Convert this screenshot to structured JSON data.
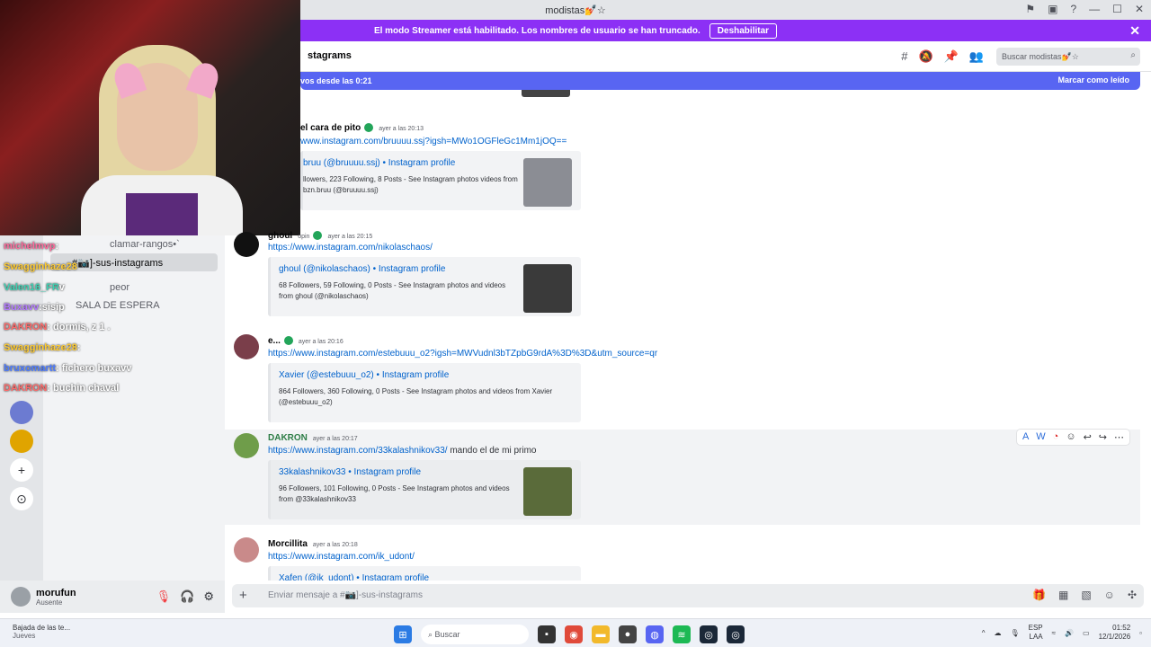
{
  "window": {
    "title": "modistas💅☆",
    "controls": [
      "flag-icon",
      "inbox-icon",
      "help-icon",
      "minimize-icon",
      "maximize-icon",
      "close-icon"
    ]
  },
  "streamer_banner": {
    "text": "El modo Streamer está habilitado. Los nombres de usuario se han truncado.",
    "button": "Deshabilitar"
  },
  "channel_header": {
    "name": "stagrams",
    "search_placeholder": "Buscar modistas💅☆"
  },
  "new_messages_bar": {
    "text": "vos desde las 0:21",
    "mark_read": "Marcar como leído"
  },
  "sidebar": {
    "channels": [
      {
        "label": "clamar-rangos•`",
        "active": false
      },
      {
        "label": "#📷]-sus-instagrams",
        "active": true
      },
      {
        "label": "peor",
        "active": false
      },
      {
        "label": "SALA DE ESPERA",
        "active": false
      }
    ]
  },
  "stream_chat": [
    {
      "name": "michelmvp",
      "text": ":"
    },
    {
      "name": "Swagginhaze28",
      "text": ""
    },
    {
      "name": "Valen16_FR",
      "text": "v"
    },
    {
      "name": "Buxavv",
      "text": ":sisip"
    },
    {
      "name": "DAKRON",
      "text": ": dormis, z 1 ."
    },
    {
      "name": "Swagginhaze28",
      "text": ":"
    },
    {
      "name": "bruxomartt",
      "text": ": fichero buxavv"
    },
    {
      "name": "DAKRON",
      "text": ": buchin chaval"
    }
  ],
  "user_panel": {
    "name": "morufun",
    "status": "Ausente"
  },
  "messages": [
    {
      "author": "el cara de pito",
      "timestamp": "ayer a las 20:13",
      "link": "www.instagram.com/bruuuu.ssj?igsh=MWo1OGFleGc1Mm1jOQ==",
      "embed_title": "bruu (@bruuuu.ssj) • Instagram profile",
      "embed_desc": "llowers, 223 Following, 8 Posts - See Instagram photos videos from bzn.bruu (@bruuuu.ssj)"
    },
    {
      "author": "ghoul",
      "tag": "opin",
      "timestamp": "ayer a las 20:15",
      "link": "https://www.instagram.com/nikolaschaos/",
      "embed_title": "ghoul (@nikolaschaos) • Instagram profile",
      "embed_desc": "68 Followers, 59 Following, 0 Posts - See Instagram photos and videos from ghoul (@nikolaschaos)"
    },
    {
      "author": "e...",
      "timestamp": "ayer a las 20:16",
      "link": "https://www.instagram.com/estebuuu_o2?igsh=MWVudnl3bTZpbG9rdA%3D%3D&utm_source=qr",
      "embed_title": "Xavier (@estebuuu_o2) • Instagram profile",
      "embed_desc": "864 Followers, 360 Following, 0 Posts - See Instagram photos and videos from Xavier (@estebuuu_o2)"
    },
    {
      "author": "DAKRON",
      "timestamp": "ayer a las 20:17",
      "link": "https://www.instagram.com/33kalashnikov33/",
      "after_link": " mando el de mi primo",
      "embed_title": "33kalashnikov33 • Instagram profile",
      "embed_desc": "96 Followers, 101 Following, 0 Posts - See Instagram photos and videos from @33kalashnikov33"
    },
    {
      "author": "Morcillita",
      "timestamp": "ayer a las 20:18",
      "link": "https://www.instagram.com/ik_udont/",
      "embed_title": "Xafen (@ik_udont) • Instagram profile",
      "embed_desc": ""
    }
  ],
  "composer": {
    "placeholder": "Enviar mensaje a #📷]-sus-instagrams"
  },
  "taskbar": {
    "weather_line1": "Bajada de las te...",
    "weather_line2": "Jueves",
    "search_placeholder": "Buscar",
    "lang1": "ESP",
    "lang2": "LAA",
    "time": "01:52",
    "date": "12/1/2026"
  },
  "colors": {
    "streamer_purple": "#8c30f5",
    "blurple": "#5865f2",
    "link_blue": "#0062cc",
    "online_green": "#23a55a"
  }
}
